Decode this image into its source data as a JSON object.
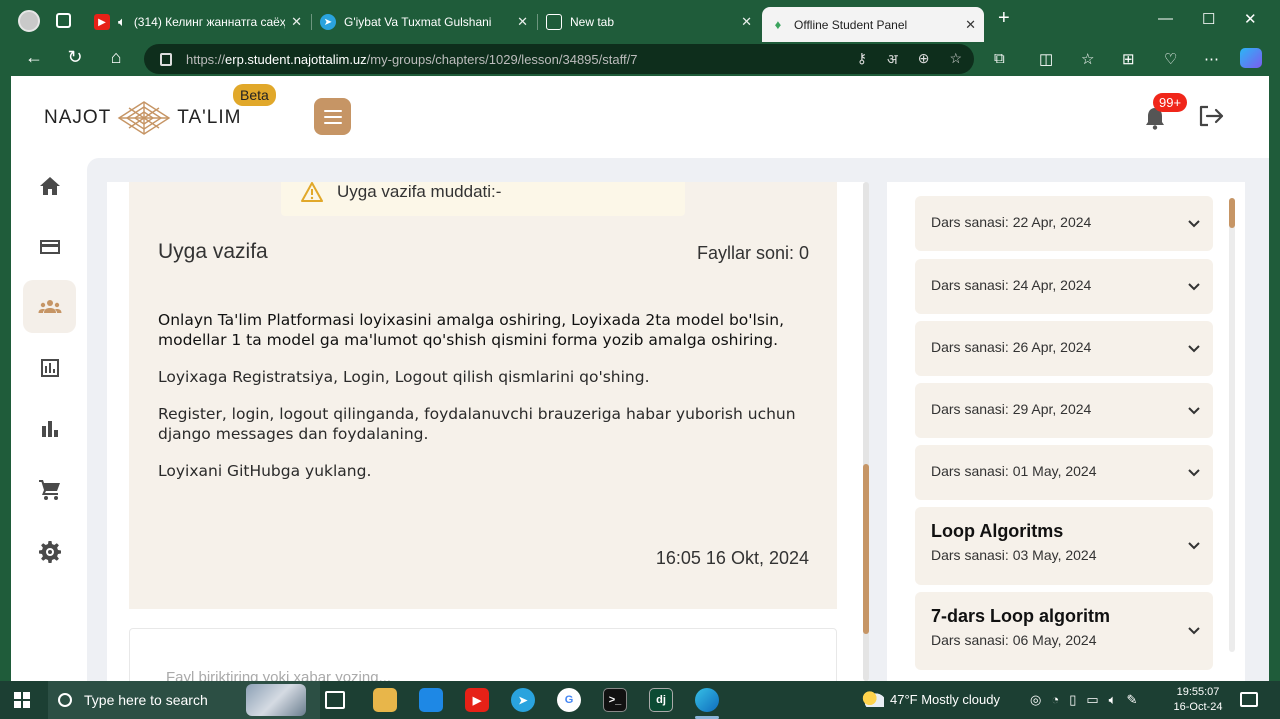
{
  "browser": {
    "tabs": [
      {
        "title": "(314) Келинг жаннатга саёҳ",
        "favicon": "youtube-icon",
        "color": "#e62117"
      },
      {
        "title": "G'iybat Va Tuxmat Gulshani",
        "favicon": "telegram-icon",
        "color": "#2aa3de"
      },
      {
        "title": "New tab",
        "favicon": "newtab-icon",
        "color": "#444444"
      },
      {
        "title": "Offline Student Panel",
        "favicon": "najot-icon",
        "color": "#3aa35d"
      }
    ],
    "url": {
      "proto": "https://",
      "host": "erp.student.najottalim.uz",
      "path": "/my-groups/chapters/1029/lesson/34895/staff/7"
    }
  },
  "header": {
    "logo_left": "NAJOT",
    "logo_right": "TA'LIM",
    "beta": "Beta",
    "notifications": "99+"
  },
  "sidebar": {
    "items": [
      {
        "name": "home-icon",
        "active": false
      },
      {
        "name": "card-icon",
        "active": false
      },
      {
        "name": "groups-icon",
        "active": true
      },
      {
        "name": "report-icon",
        "active": false
      },
      {
        "name": "stats-icon",
        "active": false
      },
      {
        "name": "cart-icon",
        "active": false
      },
      {
        "name": "gear-icon",
        "active": false
      }
    ]
  },
  "homework": {
    "deadline_label": "Uyga vazifa muddati:-",
    "title": "Uyga vazifa",
    "files": "Fayllar soni: 0",
    "paragraphs": [
      "Onlayn Ta'lim Platformasi loyixasini amalga oshiring, Loyixada 2ta model bo'lsin, modellar 1 ta model ga ma'lumot qo'shish qismini forma yozib amalga oshiring.",
      "Loyixaga Registratsiya, Login, Logout qilish qismlarini qo'shing.",
      "Register, login, logout qilinganda, foydalanuvchi brauzeriga habar yuborish uchun django messages dan foydalaning.",
      "Loyixani GitHubga yuklang."
    ],
    "timestamp": "16:05 16 Okt, 2024",
    "comment_placeholder": "Fayl biriktiring yoki xabar yozing..."
  },
  "lessons": [
    {
      "name": "",
      "date": "Dars sanasi: 22 Apr, 2024"
    },
    {
      "name": "",
      "date": "Dars sanasi: 24 Apr, 2024"
    },
    {
      "name": "",
      "date": "Dars sanasi: 26 Apr, 2024"
    },
    {
      "name": "",
      "date": "Dars sanasi: 29 Apr, 2024"
    },
    {
      "name": "",
      "date": "Dars sanasi: 01 May, 2024"
    },
    {
      "name": "Loop Algoritms",
      "date": "Dars sanasi: 03 May, 2024"
    },
    {
      "name": "7-dars Loop algoritm",
      "date": "Dars sanasi: 06 May, 2024"
    }
  ],
  "taskbar": {
    "search_placeholder": "Type here to search",
    "weather": "47°F  Mostly cloudy",
    "time": "19:55:07",
    "date": "16-Oct-24"
  },
  "colors": {
    "accent": "#c69565",
    "card_bg": "#f6f1ea",
    "beta": "#e1a82a",
    "badge": "#f0261a",
    "browser_frame": "#1f5c3a"
  }
}
